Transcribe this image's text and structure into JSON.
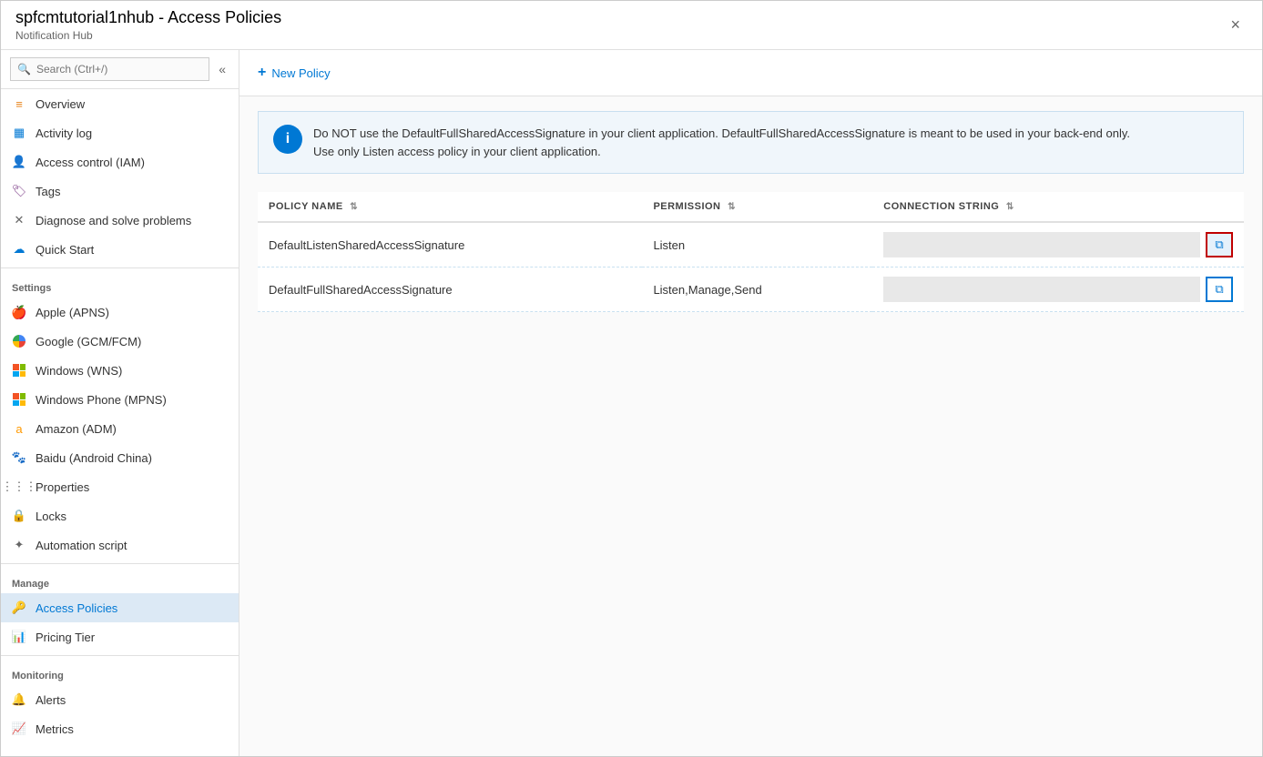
{
  "titleBar": {
    "title": "spfcmtutorial1nhub - Access Policies",
    "subtitle": "Notification Hub",
    "closeLabel": "×"
  },
  "sidebar": {
    "searchPlaceholder": "Search (Ctrl+/)",
    "collapseIcon": "«",
    "items": [
      {
        "id": "overview",
        "label": "Overview",
        "icon": "overview",
        "section": null
      },
      {
        "id": "activity-log",
        "label": "Activity log",
        "icon": "activity",
        "section": null
      },
      {
        "id": "access-control",
        "label": "Access control (IAM)",
        "icon": "iam",
        "section": null
      },
      {
        "id": "tags",
        "label": "Tags",
        "icon": "tags",
        "section": null
      },
      {
        "id": "diagnose",
        "label": "Diagnose and solve problems",
        "icon": "diagnose",
        "section": null
      },
      {
        "id": "quick-start",
        "label": "Quick Start",
        "icon": "quickstart",
        "section": null
      }
    ],
    "sections": [
      {
        "label": "Settings",
        "items": [
          {
            "id": "apple",
            "label": "Apple (APNS)",
            "icon": "apple"
          },
          {
            "id": "google",
            "label": "Google (GCM/FCM)",
            "icon": "google"
          },
          {
            "id": "windows",
            "label": "Windows (WNS)",
            "icon": "windows"
          },
          {
            "id": "windows-phone",
            "label": "Windows Phone (MPNS)",
            "icon": "windows"
          },
          {
            "id": "amazon",
            "label": "Amazon (ADM)",
            "icon": "amazon"
          },
          {
            "id": "baidu",
            "label": "Baidu (Android China)",
            "icon": "baidu"
          },
          {
            "id": "properties",
            "label": "Properties",
            "icon": "properties"
          },
          {
            "id": "locks",
            "label": "Locks",
            "icon": "locks"
          },
          {
            "id": "automation",
            "label": "Automation script",
            "icon": "automation"
          }
        ]
      },
      {
        "label": "Manage",
        "items": [
          {
            "id": "access-policies",
            "label": "Access Policies",
            "icon": "key",
            "active": true
          },
          {
            "id": "pricing-tier",
            "label": "Pricing Tier",
            "icon": "pricing"
          }
        ]
      },
      {
        "label": "Monitoring",
        "items": [
          {
            "id": "alerts",
            "label": "Alerts",
            "icon": "alerts"
          },
          {
            "id": "metrics",
            "label": "Metrics",
            "icon": "metrics"
          }
        ]
      }
    ]
  },
  "toolbar": {
    "newPolicyLabel": "New Policy",
    "plusIcon": "+"
  },
  "infoBanner": {
    "icon": "i",
    "line1": "Do NOT use the DefaultFullSharedAccessSignature in your client application.  DefaultFullSharedAccessSignature is meant to be used in your back-end only.",
    "line2": "Use only Listen access policy in your client application."
  },
  "table": {
    "columns": [
      {
        "id": "policy-name",
        "label": "POLICY NAME",
        "sortIcon": "⇅"
      },
      {
        "id": "permission",
        "label": "PERMISSION",
        "sortIcon": "⇅"
      },
      {
        "id": "connection-string",
        "label": "CONNECTION STRING",
        "sortIcon": "⇅"
      }
    ],
    "rows": [
      {
        "policyName": "DefaultListenSharedAccessSignature",
        "permission": "Listen",
        "connectionString": "",
        "copyHighlighted": true
      },
      {
        "policyName": "DefaultFullSharedAccessSignature",
        "permission": "Listen,Manage,Send",
        "connectionString": "",
        "copyHighlighted": false
      }
    ]
  }
}
